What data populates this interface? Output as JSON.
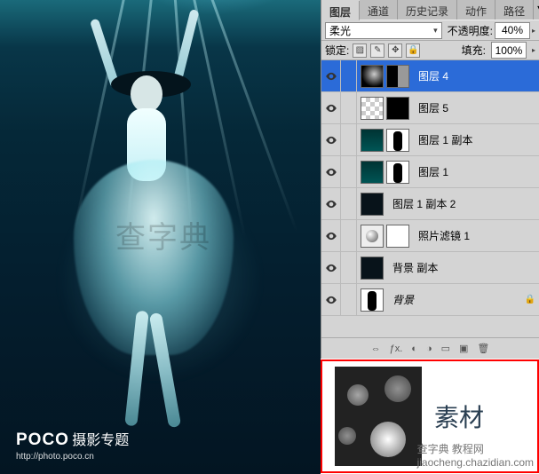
{
  "tabs": {
    "layers": "图层",
    "channels": "通道",
    "history": "历史记录",
    "actions": "动作",
    "paths": "路径"
  },
  "blend_mode": "柔光",
  "opacity_label": "不透明度:",
  "opacity_value": "40%",
  "lock_label": "锁定:",
  "fill_label": "填充:",
  "fill_value": "100%",
  "layers": [
    {
      "name": "图层 4"
    },
    {
      "name": "图层 5"
    },
    {
      "name": "图层 1 副本"
    },
    {
      "name": "图层 1"
    },
    {
      "name": "图层 1 副本 2"
    },
    {
      "name": "照片滤镜 1"
    },
    {
      "name": "背景 副本"
    },
    {
      "name": "背景"
    }
  ],
  "material_label": "素材",
  "watermark": {
    "brand": "POCO",
    "title": "摄影专题",
    "url": "http://photo.poco.cn"
  },
  "center_watermark": "查字典",
  "footer_watermark": "查字典 教程网",
  "footer_url": "jiaocheng.chazidian.com"
}
